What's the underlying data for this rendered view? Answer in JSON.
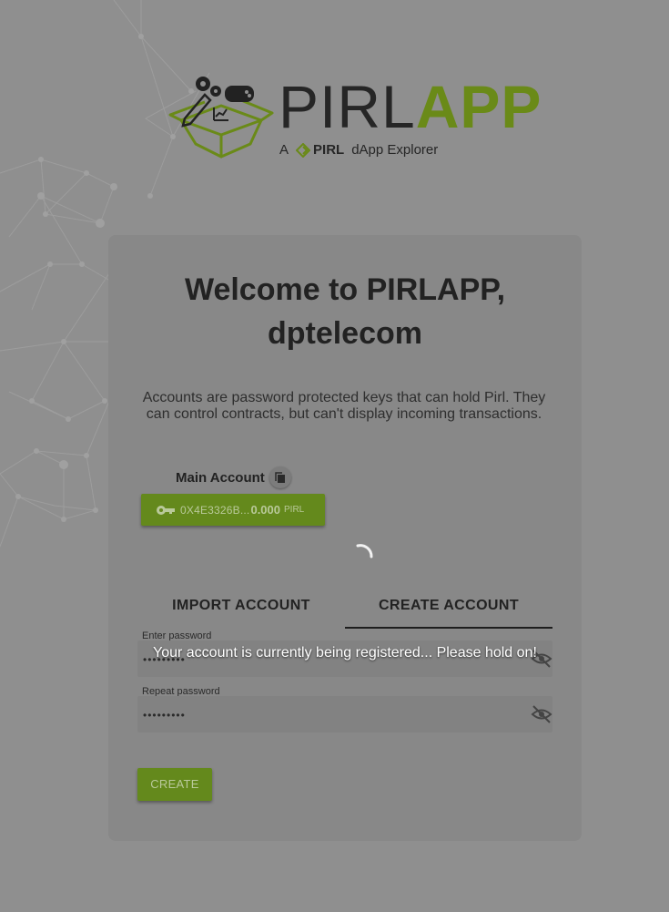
{
  "logo": {
    "word_left": "PIRL",
    "word_right": "APP",
    "tagline_prefix": "A",
    "tagline_brand": "PIRL",
    "tagline_suffix": "dApp Explorer"
  },
  "welcome": {
    "line1": "Welcome to PIRLAPP,",
    "line2": "dptelecom"
  },
  "intro_text": "Accounts are password protected keys that can hold Pirl. They can control contracts, but can't display incoming transactions.",
  "main_account": {
    "label": "Main Account",
    "address": "0X4E3326B...",
    "balance": "0.000",
    "unit": "PIRL",
    "copy_icon": "copy-icon",
    "key_icon": "key-icon"
  },
  "tabs": [
    {
      "label": "IMPORT ACCOUNT",
      "active": false
    },
    {
      "label": "CREATE ACCOUNT",
      "active": true
    }
  ],
  "password": {
    "label": "Enter password",
    "value": "•••••••••",
    "icon": "eye-off-icon"
  },
  "repeat_password": {
    "label": "Repeat password",
    "value": "•••••••••",
    "icon": "eye-off-icon"
  },
  "create_button": "CREATE",
  "toast": "Your account is currently being registered... Please hold on!",
  "colors": {
    "overlay_background": "#8f8f8f",
    "card": "#888888",
    "accent_green": "#64891c",
    "logo_green": "#6a8a18",
    "text_dark": "#222222"
  }
}
